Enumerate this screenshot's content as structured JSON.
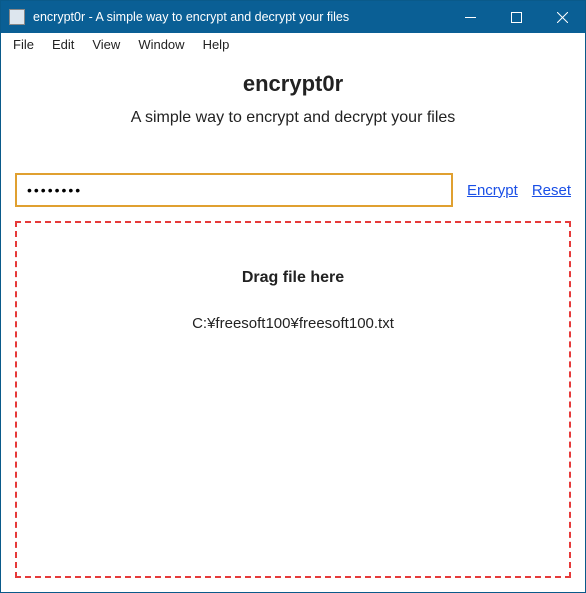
{
  "window": {
    "title": "encrypt0r - A simple way to encrypt and decrypt your files"
  },
  "menu": {
    "items": [
      "File",
      "Edit",
      "View",
      "Window",
      "Help"
    ]
  },
  "main": {
    "heading": "encrypt0r",
    "subheading": "A simple way to encrypt and decrypt your files",
    "password_value": "••••••••",
    "encrypt_label": "Encrypt",
    "reset_label": "Reset"
  },
  "dropzone": {
    "heading": "Drag file here",
    "file_path": "C:¥freesoft100¥freesoft100.txt"
  }
}
